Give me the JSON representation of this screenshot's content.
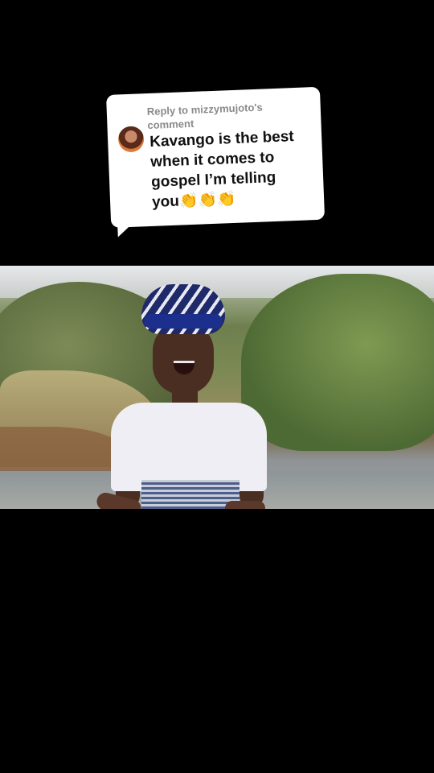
{
  "reply": {
    "header": "Reply to mizzymujoto's comment",
    "comment": "Kavango is the best\nwhen it comes to\ngospel I’m telling\nyou👏👏👏"
  },
  "avatar_icon": "user-avatar-icon",
  "colors": {
    "background": "#000000",
    "card": "#ffffff",
    "header_text": "#8a8a8a",
    "comment_text": "#111111"
  }
}
